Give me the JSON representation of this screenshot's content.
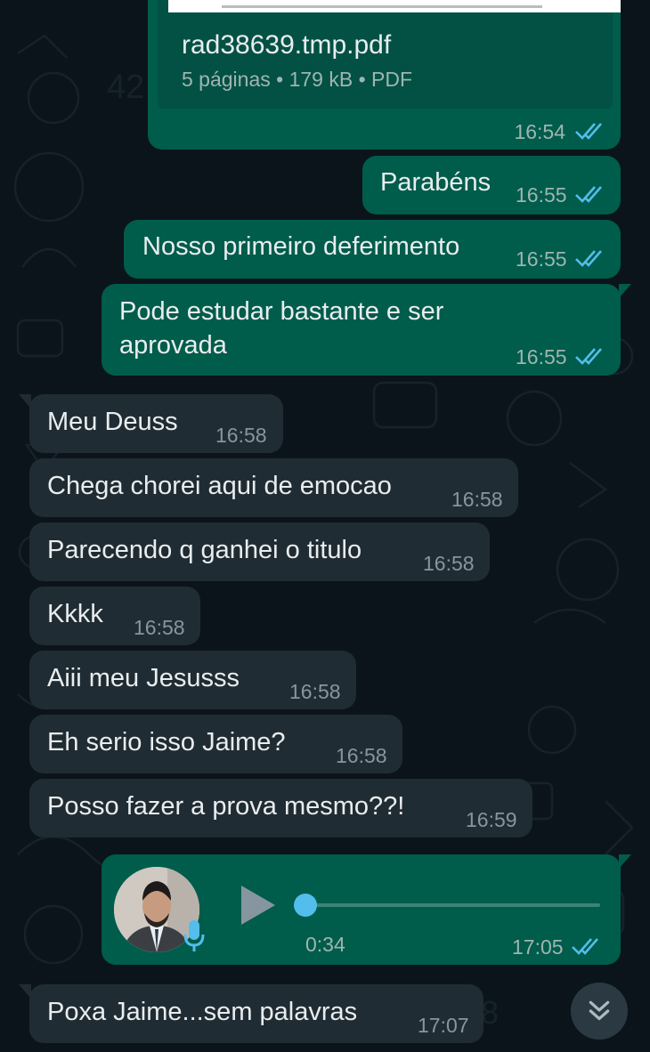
{
  "colors": {
    "background": "#0b141a",
    "outgoing_bubble": "#005c4b",
    "incoming_bubble": "#202c33",
    "read_ticks": "#53bdeb",
    "voice_progress": "#53bdeb"
  },
  "document_message": {
    "filename": "rad38639.tmp.pdf",
    "meta": "5 páginas • 179 kB • PDF",
    "time": "16:54",
    "status": "read"
  },
  "messages": [
    {
      "direction": "outgoing",
      "text": "Parabéns",
      "time": "16:55",
      "status": "read"
    },
    {
      "direction": "outgoing",
      "text": "Nosso primeiro deferimento",
      "time": "16:55",
      "status": "read"
    },
    {
      "direction": "outgoing",
      "text": "Pode estudar bastante e ser aprovada",
      "time": "16:55",
      "status": "read"
    },
    {
      "direction": "incoming",
      "text": "Meu Deuss",
      "time": "16:58"
    },
    {
      "direction": "incoming",
      "text": "Chega chorei aqui de emocao",
      "time": "16:58"
    },
    {
      "direction": "incoming",
      "text": "Parecendo q ganhei o titulo",
      "time": "16:58"
    },
    {
      "direction": "incoming",
      "text": "Kkkk",
      "time": "16:58"
    },
    {
      "direction": "incoming",
      "text": "Aiii meu Jesusss",
      "time": "16:58"
    },
    {
      "direction": "incoming",
      "text": "Eh serio isso Jaime?",
      "time": "16:58"
    },
    {
      "direction": "incoming",
      "text": "Posso fazer a prova mesmo??!",
      "time": "16:59"
    }
  ],
  "voice_message": {
    "direction": "outgoing",
    "duration": "0:34",
    "time": "17:05",
    "status": "read",
    "progress": 0.0,
    "icons": [
      "avatar",
      "mic-icon",
      "play-icon"
    ]
  },
  "last_message": {
    "direction": "incoming",
    "text": "Poxa Jaime...sem palavras",
    "time": "17:07"
  },
  "scroll_button": {
    "icon": "double-chevron-down-icon"
  }
}
